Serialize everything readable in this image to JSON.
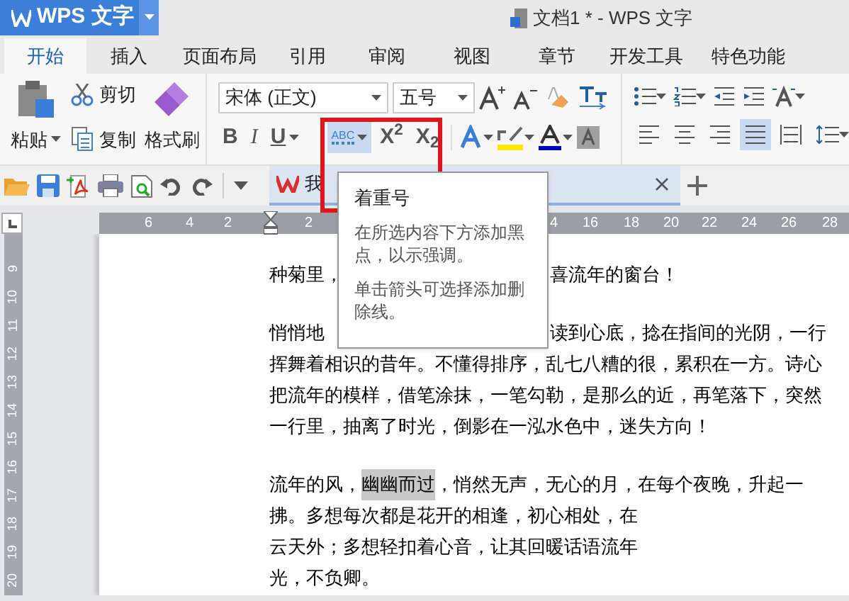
{
  "app_button": {
    "label": "WPS 文字"
  },
  "window": {
    "title": "文档1 * - WPS 文字"
  },
  "tabs": [
    {
      "label": "开始",
      "selected": true
    },
    {
      "label": "插入",
      "selected": false
    },
    {
      "label": "页面布局",
      "selected": false
    },
    {
      "label": "引用",
      "selected": false
    },
    {
      "label": "审阅",
      "selected": false
    },
    {
      "label": "视图",
      "selected": false
    },
    {
      "label": "章节",
      "selected": false
    },
    {
      "label": "开发工具",
      "selected": false
    },
    {
      "label": "特色功能",
      "selected": false
    }
  ],
  "clipboard": {
    "paste": "粘贴",
    "cut": "剪切",
    "copy": "复制",
    "format_painter": "格式刷"
  },
  "font": {
    "family": "宋体 (正文)",
    "size": "五号"
  },
  "format_buttons": [
    {
      "kind": "bold",
      "label": "B",
      "selected": false
    },
    {
      "kind": "italic",
      "label": "I",
      "selected": false
    },
    {
      "kind": "underline",
      "label": "U",
      "selected": false
    },
    {
      "kind": "emphasis",
      "label": "ABC",
      "selected": true
    },
    {
      "kind": "superscript",
      "label": "X$^{2}$",
      "selected": false
    },
    {
      "kind": "subscript",
      "label": "X$_{2}$",
      "selected": false
    }
  ],
  "align_buttons": [
    {
      "kind": "left",
      "selected": false
    },
    {
      "kind": "center",
      "selected": false
    },
    {
      "kind": "right",
      "selected": false
    },
    {
      "kind": "justify",
      "selected": true
    },
    {
      "kind": "distributed",
      "selected": false
    }
  ],
  "document_tab": {
    "label": "我"
  },
  "tooltip": {
    "title": "着重号",
    "lines": [
      "在所选内容下方添加黑点，以示强调。",
      "单击箭头可选择添加删除线。"
    ]
  },
  "horizontal_ruler": [
    "6",
    "4",
    "2",
    "2",
    "4",
    "16",
    "18",
    "20",
    "22",
    "24",
    "26",
    "28"
  ],
  "vertical_ruler": [
    "9",
    "10",
    "11",
    "12",
    "13",
    "14",
    "15",
    "16",
    "17",
    "18",
    "19",
    "20"
  ],
  "paragraphs": [
    {
      "lines": [
        {
          "covered_by_tooltip": true,
          "segments": [
            {
              "text": "种菊里，",
              "highlighted": false
            },
            {
              "text": "喜流年的窗台！",
              "highlighted": false
            }
          ]
        }
      ]
    },
    {
      "lines": [
        {
          "covered_by_tooltip": true,
          "segments": [
            {
              "text": "悄悄地",
              "highlighted": false
            },
            {
              "text": "读到心底，捻在指间的光阴，一行",
              "highlighted": false
            }
          ]
        },
        {
          "covered_by_tooltip": false,
          "segments": [
            {
              "text": "挥舞着相识的昔年。不懂得排序，乱七八糟的很，累积在一方。诗心",
              "highlighted": false
            }
          ]
        },
        {
          "covered_by_tooltip": false,
          "segments": [
            {
              "text": "把流年的模样，借笔涂抹，一笔勾勒，是那么的近，再笔落下，突然",
              "highlighted": false
            }
          ]
        },
        {
          "covered_by_tooltip": false,
          "segments": [
            {
              "text": "一行里，抽离了时光，倒影在一泓水色中，迷失方向！",
              "highlighted": false
            }
          ]
        }
      ]
    },
    {
      "lines": [
        {
          "covered_by_tooltip": false,
          "segments": [
            {
              "text": "流年的风，",
              "highlighted": false
            },
            {
              "text": "幽幽而过",
              "highlighted": true
            },
            {
              "text": "，悄然无声，无心的月，在每个夜晚，升起一",
              "highlighted": false
            }
          ]
        },
        {
          "covered_by_tooltip": false,
          "segments": [
            {
              "text": "拂。多想每次都是花开的相逢，初心相处，在",
              "highlighted": false
            }
          ]
        },
        {
          "covered_by_tooltip": false,
          "segments": [
            {
              "text": "云天外；多想轻扣着心音，让其回暖话语流年",
              "highlighted": false
            }
          ]
        },
        {
          "covered_by_tooltip": false,
          "segments": [
            {
              "text": "光，不负卿。",
              "highlighted": false
            }
          ]
        }
      ]
    }
  ]
}
